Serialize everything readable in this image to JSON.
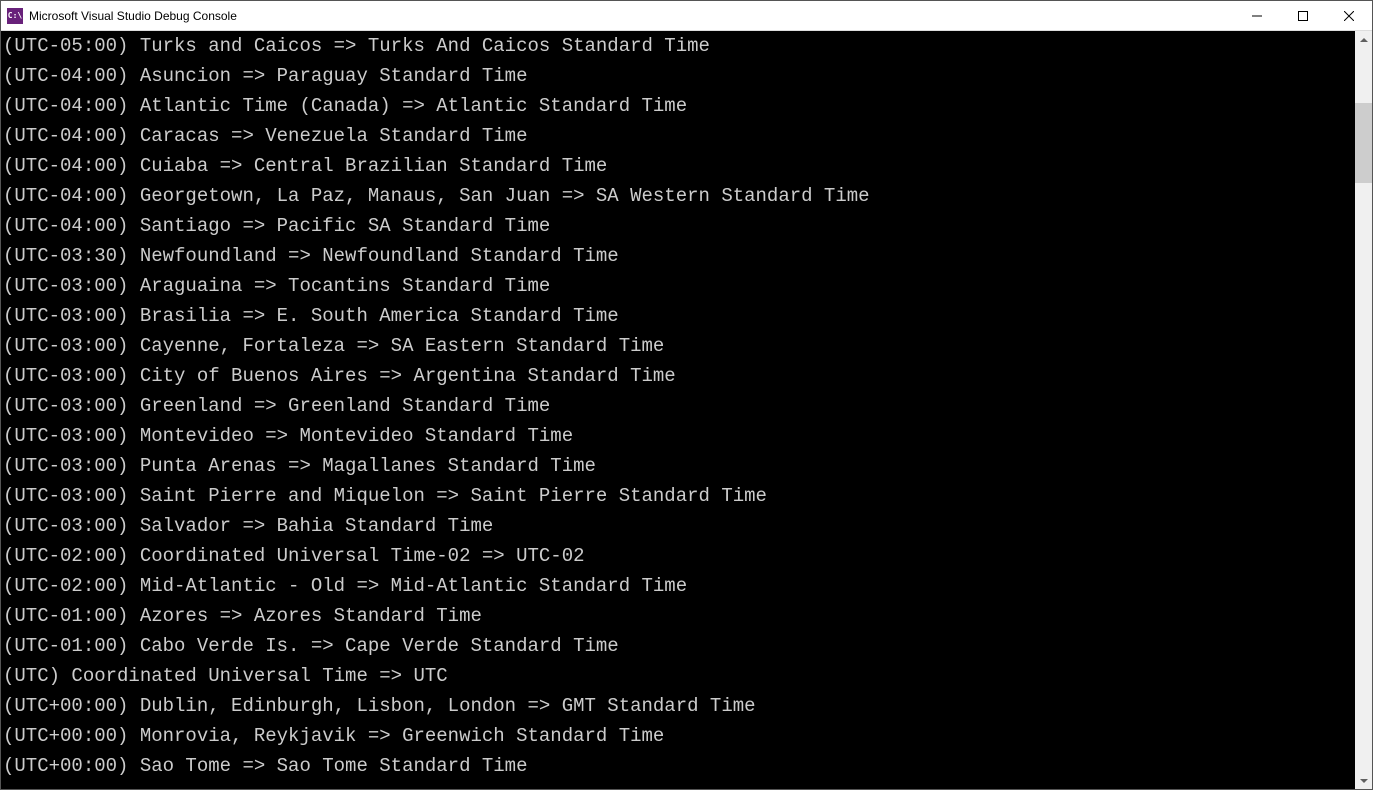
{
  "window": {
    "title": "Microsoft Visual Studio Debug Console",
    "icon_text": "C:\\"
  },
  "console": {
    "lines": [
      "(UTC-05:00) Turks and Caicos => Turks And Caicos Standard Time",
      "(UTC-04:00) Asuncion => Paraguay Standard Time",
      "(UTC-04:00) Atlantic Time (Canada) => Atlantic Standard Time",
      "(UTC-04:00) Caracas => Venezuela Standard Time",
      "(UTC-04:00) Cuiaba => Central Brazilian Standard Time",
      "(UTC-04:00) Georgetown, La Paz, Manaus, San Juan => SA Western Standard Time",
      "(UTC-04:00) Santiago => Pacific SA Standard Time",
      "(UTC-03:30) Newfoundland => Newfoundland Standard Time",
      "(UTC-03:00) Araguaina => Tocantins Standard Time",
      "(UTC-03:00) Brasilia => E. South America Standard Time",
      "(UTC-03:00) Cayenne, Fortaleza => SA Eastern Standard Time",
      "(UTC-03:00) City of Buenos Aires => Argentina Standard Time",
      "(UTC-03:00) Greenland => Greenland Standard Time",
      "(UTC-03:00) Montevideo => Montevideo Standard Time",
      "(UTC-03:00) Punta Arenas => Magallanes Standard Time",
      "(UTC-03:00) Saint Pierre and Miquelon => Saint Pierre Standard Time",
      "(UTC-03:00) Salvador => Bahia Standard Time",
      "(UTC-02:00) Coordinated Universal Time-02 => UTC-02",
      "(UTC-02:00) Mid-Atlantic - Old => Mid-Atlantic Standard Time",
      "(UTC-01:00) Azores => Azores Standard Time",
      "(UTC-01:00) Cabo Verde Is. => Cape Verde Standard Time",
      "(UTC) Coordinated Universal Time => UTC",
      "(UTC+00:00) Dublin, Edinburgh, Lisbon, London => GMT Standard Time",
      "(UTC+00:00) Monrovia, Reykjavik => Greenwich Standard Time",
      "(UTC+00:00) Sao Tome => Sao Tome Standard Time"
    ]
  }
}
